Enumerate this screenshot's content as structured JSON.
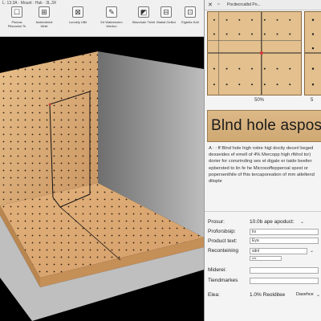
{
  "toolbar": {
    "title": "Ĺ: 13.3A · Mount : Huk  · 3L.3X",
    "buttons": [
      {
        "label": "Pluinas Pibiomlini Tk",
        "icon": "☐"
      },
      {
        "label": "Nalvindmidl Wbiti",
        "icon": "⊞"
      },
      {
        "label": "Lunnbly UBii",
        "icon": "⊠"
      },
      {
        "label": "Ed Wateesnem Werlicn",
        "icon": "✎"
      },
      {
        "label": "Sitarchale Tb/iet",
        "icon": "◩"
      },
      {
        "label": "Biatiat Geiliot",
        "icon": "⊟"
      },
      {
        "label": "Eigtetla Sciil",
        "icon": "⊡"
      }
    ]
  },
  "panel": {
    "title": "Pocitecrcalbd Po...",
    "thumb_caption_left": "50%",
    "thumb_caption_right": "5",
    "banner": "Blnd hole aspost",
    "description": "A : : ff Blnd hole high rotire higl docity decerl beged desseides ef emell of 4% Mercopp high rfkhol tor) dorier for consrinding ses et digale er taide beelier epbersted to lin fe he Microsoffepperoal spest or popersenthile of fhis tercaporeation of mm atleltend dliople",
    "properties": [
      {
        "label": "Prosur:",
        "value": "10.0b ape apoduct:",
        "field": ""
      },
      {
        "label": "Proforsbsip:",
        "value": "",
        "field": "lrs"
      },
      {
        "label": "Product text:",
        "value": "",
        "field": "Eya"
      },
      {
        "label": "Reconteining",
        "value": "",
        "field": "sdnl"
      },
      {
        "label": "Miderei:",
        "value": "",
        "field": ""
      },
      {
        "label": "Tiendmarkes",
        "value": "",
        "field": ""
      },
      {
        "label": "Elea:",
        "value": "1.0% Reolditee",
        "field": "Dasehce"
      }
    ],
    "sub_field": "o/s"
  },
  "colors": {
    "wood": "#d9a874",
    "wall_shadow": "#9a9a9a",
    "panel_bg": "#f4f4f4"
  }
}
